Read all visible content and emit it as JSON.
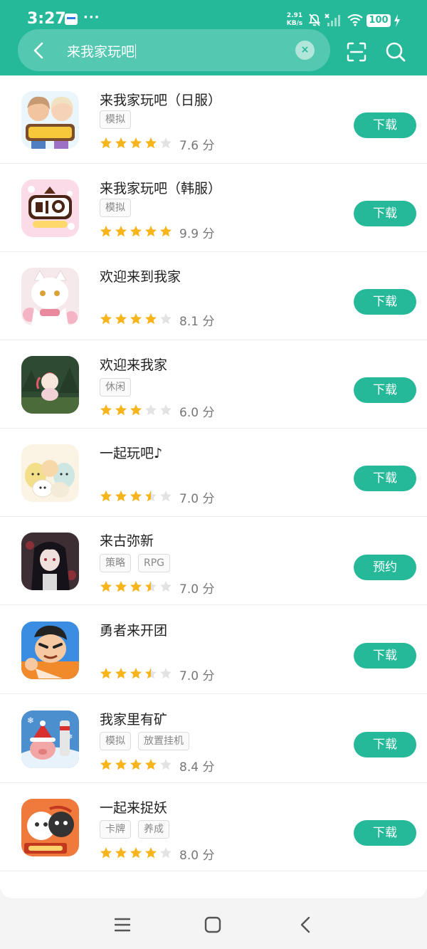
{
  "status_bar": {
    "time": "3:27",
    "dots": "···",
    "net_speed_value": "2.91",
    "net_speed_unit": "KB/s",
    "battery": "100"
  },
  "search": {
    "query": "来我家玩吧",
    "clear_glyph": "×"
  },
  "colors": {
    "accent": "#25b99a",
    "star": "#f8b51b",
    "star_empty": "#e3e3e3"
  },
  "apps": [
    {
      "name": "来我家玩吧（日服）",
      "tags": [
        "模拟"
      ],
      "stars": 4,
      "rating": "7.6 分",
      "button": "下载",
      "icon": "anime-couple-icon"
    },
    {
      "name": "来我家玩吧（韩服）",
      "tags": [
        "模拟"
      ],
      "stars": 5,
      "rating": "9.9 分",
      "button": "下载",
      "icon": "korean-logo-icon"
    },
    {
      "name": "欢迎来到我家",
      "tags": [],
      "stars": 4,
      "rating": "8.1 分",
      "button": "下载",
      "icon": "white-cat-icon"
    },
    {
      "name": "欢迎来我家",
      "tags": [
        "休闲"
      ],
      "stars": 3,
      "rating": "6.0 分",
      "button": "下载",
      "icon": "forest-girl-icon"
    },
    {
      "name": "一起玩吧♪",
      "tags": [],
      "stars": 3.5,
      "rating": "7.0 分",
      "button": "下载",
      "icon": "sumikko-icon"
    },
    {
      "name": "来古弥新",
      "tags": [
        "策略",
        "RPG"
      ],
      "stars": 3.5,
      "rating": "7.0 分",
      "button": "预约",
      "icon": "gothic-girl-icon"
    },
    {
      "name": "勇者来开团",
      "tags": [],
      "stars": 3.5,
      "rating": "7.0 分",
      "button": "下载",
      "icon": "hero-boy-icon"
    },
    {
      "name": "我家里有矿",
      "tags": [
        "模拟",
        "放置挂机"
      ],
      "stars": 4,
      "rating": "8.4 分",
      "button": "下载",
      "icon": "santa-pig-icon"
    },
    {
      "name": "一起来捉妖",
      "tags": [
        "卡牌",
        "养成"
      ],
      "stars": 4,
      "rating": "8.0 分",
      "button": "下载",
      "icon": "cute-spirits-icon"
    }
  ]
}
